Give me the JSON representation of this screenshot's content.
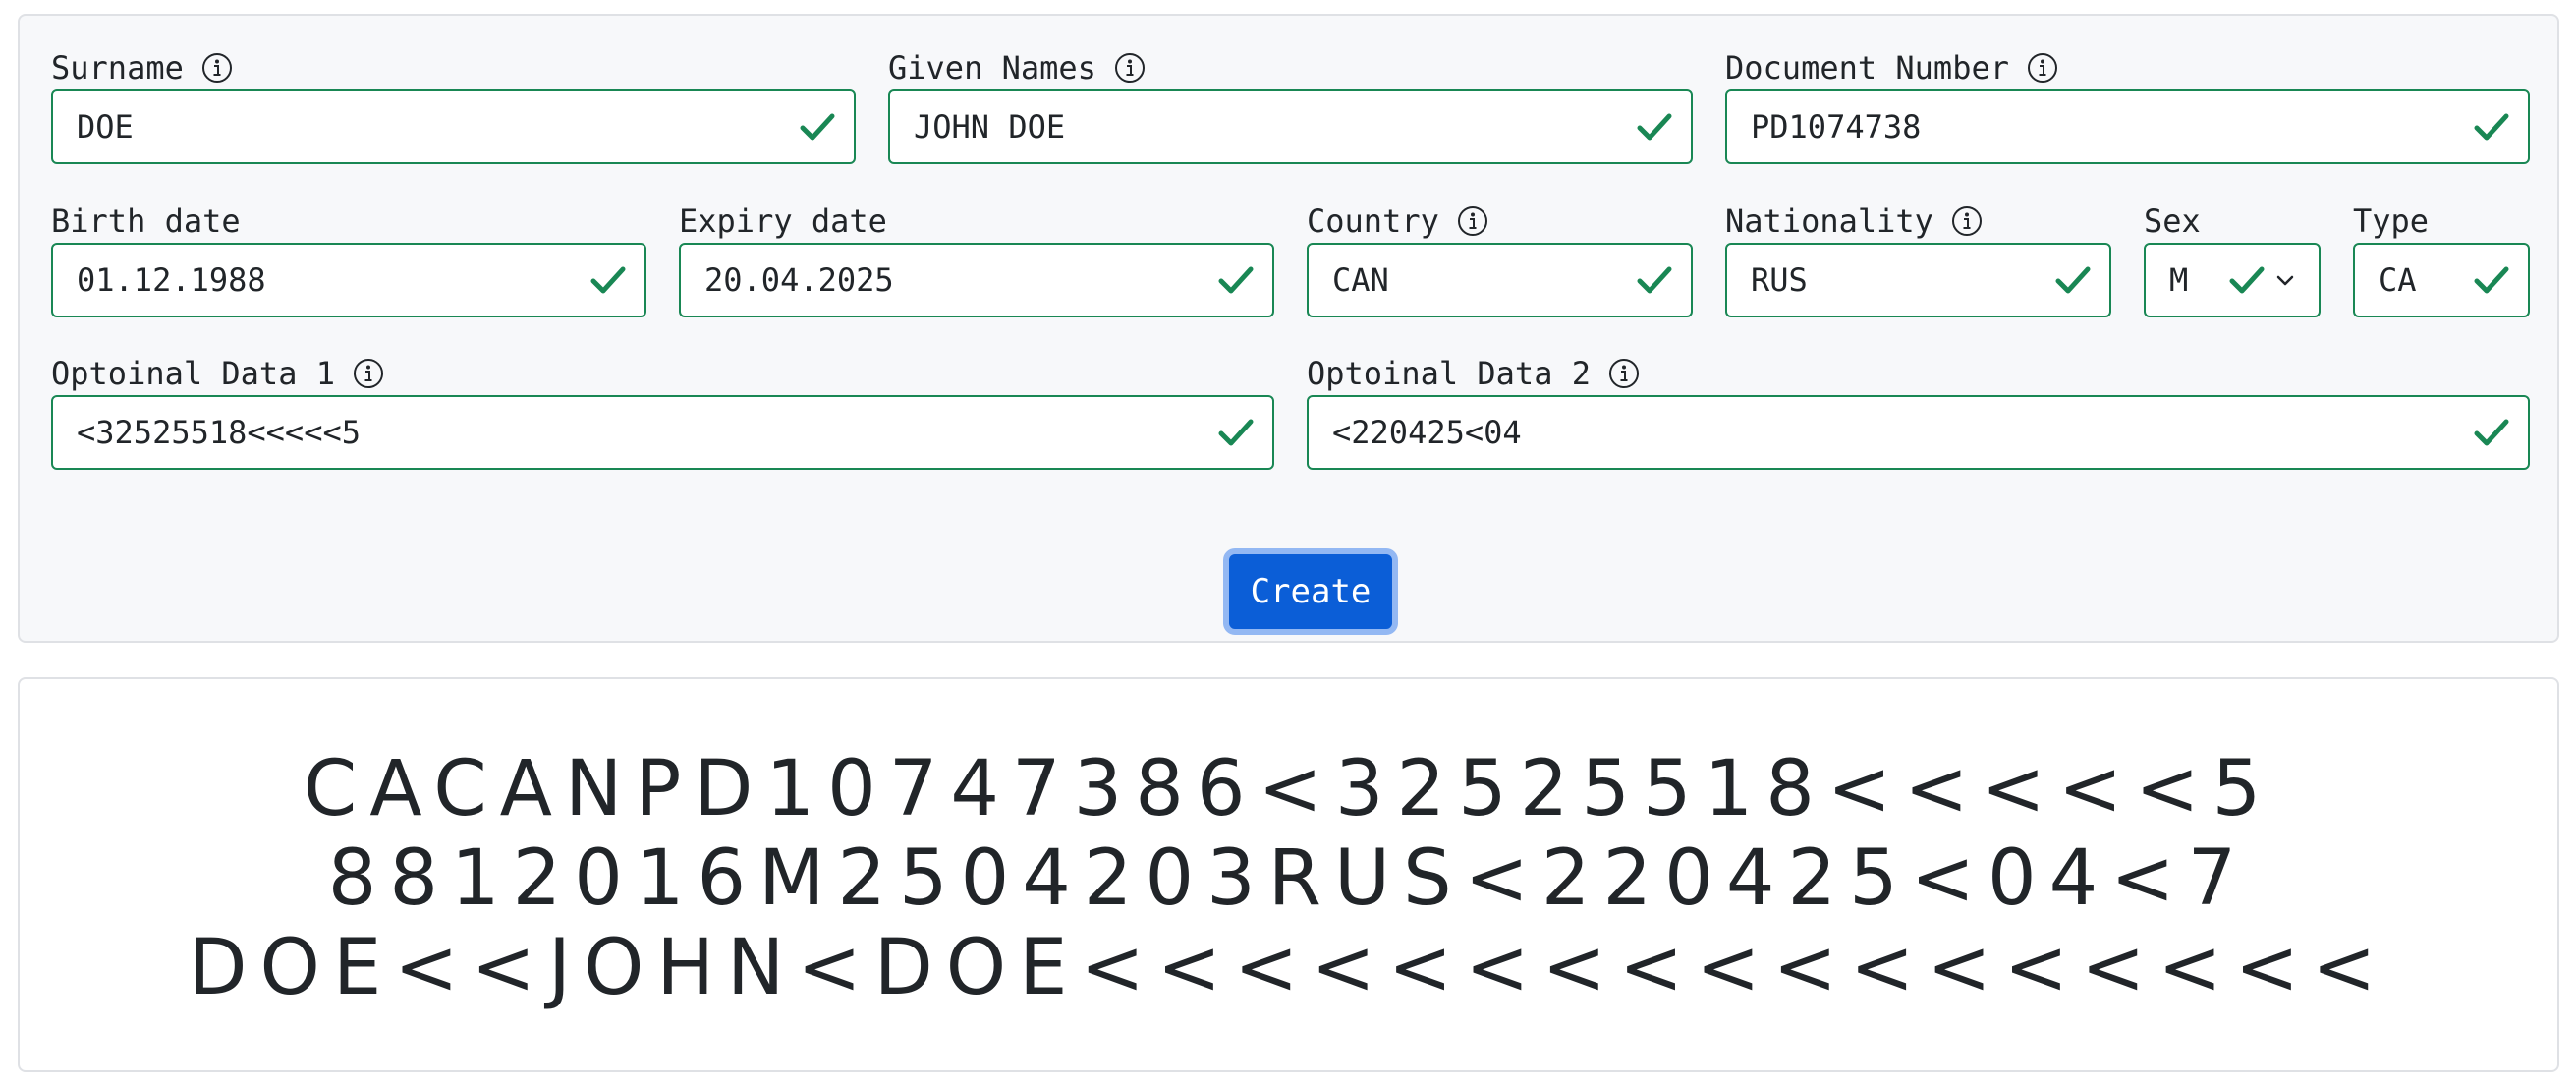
{
  "form": {
    "surname": {
      "label": "Surname",
      "value": "DOE"
    },
    "given_names": {
      "label": "Given Names",
      "value": "JOHN DOE"
    },
    "document_number": {
      "label": "Document Number",
      "value": "PD1074738"
    },
    "birth_date": {
      "label": "Birth date",
      "value": "01.12.1988"
    },
    "expiry_date": {
      "label": "Expiry date",
      "value": "20.04.2025"
    },
    "country": {
      "label": "Country",
      "value": "CAN"
    },
    "nationality": {
      "label": "Nationality",
      "value": "RUS"
    },
    "sex": {
      "label": "Sex",
      "value": "M"
    },
    "type": {
      "label": "Type",
      "value": "CA"
    },
    "optional_data_1": {
      "label": "Optoinal Data 1",
      "value": "<32525518<<<<<5"
    },
    "optional_data_2": {
      "label": "Optoinal Data 2",
      "value": "<220425<04"
    },
    "create_label": "Create"
  },
  "mrz": {
    "lines": [
      "CACANPD10747386<32525518<<<<<5",
      "8812016M2504203RUS<220425<04<7",
      "DOE<<JOHN<DOE<<<<<<<<<<<<<<<<<"
    ]
  },
  "colors": {
    "valid": "#198754",
    "primary": "#0b5ed7",
    "card_bg": "#f7f8fa"
  },
  "icons": {
    "info": "info-icon",
    "valid": "check-icon",
    "dropdown": "chevron-down-icon"
  }
}
